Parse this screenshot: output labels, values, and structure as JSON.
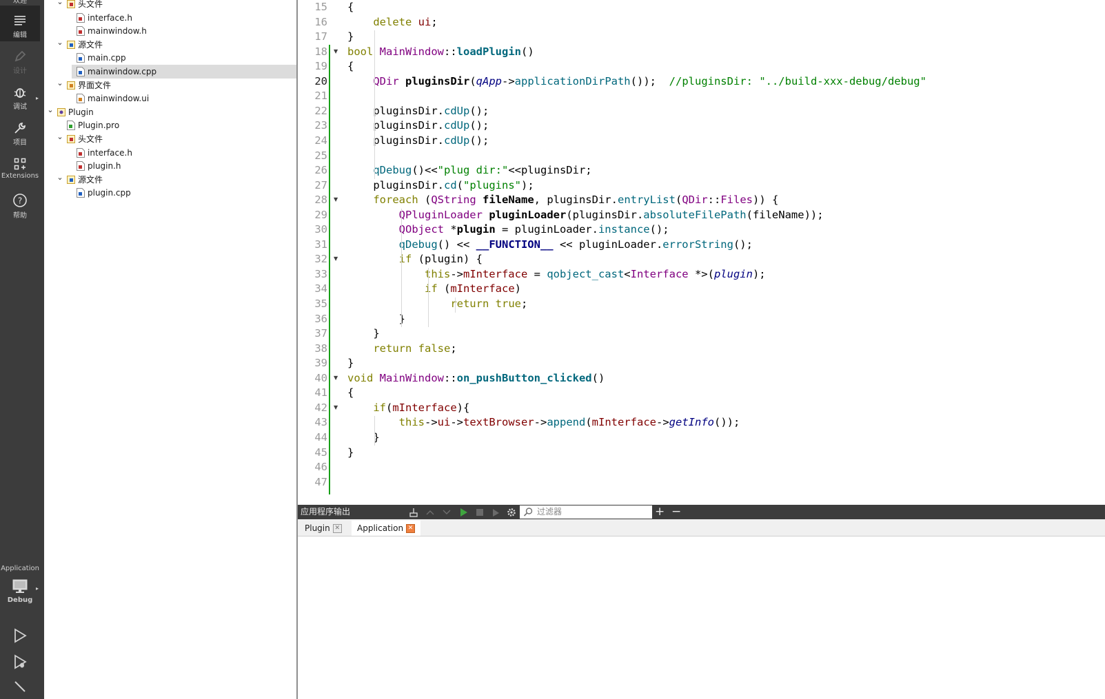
{
  "modes": {
    "welcome": "欢迎",
    "edit": "编辑",
    "design": "设计",
    "debug": "调试",
    "projects": "项目",
    "extensions": "Extensions",
    "help": "帮助"
  },
  "kit": {
    "project": "Application",
    "build": "Debug"
  },
  "tree": {
    "items": [
      {
        "label": "头文件",
        "type": "folder-h"
      },
      {
        "label": "interface.h",
        "type": "h"
      },
      {
        "label": "mainwindow.h",
        "type": "h"
      },
      {
        "label": "源文件",
        "type": "folder-cpp"
      },
      {
        "label": "main.cpp",
        "type": "cpp"
      },
      {
        "label": "mainwindow.cpp",
        "type": "cpp",
        "selected": true
      },
      {
        "label": "界面文件",
        "type": "folder-ui"
      },
      {
        "label": "mainwindow.ui",
        "type": "ui"
      },
      {
        "label": "Plugin",
        "type": "project"
      },
      {
        "label": "Plugin.pro",
        "type": "pro"
      },
      {
        "label": "头文件",
        "type": "folder-h"
      },
      {
        "label": "interface.h",
        "type": "h"
      },
      {
        "label": "plugin.h",
        "type": "h"
      },
      {
        "label": "源文件",
        "type": "folder-cpp"
      },
      {
        "label": "plugin.cpp",
        "type": "cpp"
      }
    ]
  },
  "editor": {
    "current_line": 20,
    "lines": [
      {
        "n": 15,
        "text": "{"
      },
      {
        "n": 16,
        "text": "    delete ui;"
      },
      {
        "n": 17,
        "text": "}"
      },
      {
        "n": 18,
        "text": "bool MainWindow::loadPlugin()"
      },
      {
        "n": 19,
        "text": "{"
      },
      {
        "n": 20,
        "text": "    QDir pluginsDir(qApp->applicationDirPath());  //pluginsDir: \"../build-xxx-debug/debug\""
      },
      {
        "n": 21,
        "text": ""
      },
      {
        "n": 22,
        "text": "    pluginsDir.cdUp();"
      },
      {
        "n": 23,
        "text": "    pluginsDir.cdUp();"
      },
      {
        "n": 24,
        "text": "    pluginsDir.cdUp();"
      },
      {
        "n": 25,
        "text": ""
      },
      {
        "n": 26,
        "text": "    qDebug()<<\"plug dir:\"<<pluginsDir;"
      },
      {
        "n": 27,
        "text": "    pluginsDir.cd(\"plugins\");"
      },
      {
        "n": 28,
        "text": "    foreach (QString fileName, pluginsDir.entryList(QDir::Files)) {"
      },
      {
        "n": 29,
        "text": "        QPluginLoader pluginLoader(pluginsDir.absoluteFilePath(fileName));"
      },
      {
        "n": 30,
        "text": "        QObject *plugin = pluginLoader.instance();"
      },
      {
        "n": 31,
        "text": "        qDebug() << __FUNCTION__ << pluginLoader.errorString();"
      },
      {
        "n": 32,
        "text": "        if (plugin) {"
      },
      {
        "n": 33,
        "text": "            this->mInterface = qobject_cast<Interface *>(plugin);"
      },
      {
        "n": 34,
        "text": "            if (mInterface)"
      },
      {
        "n": 35,
        "text": "                return true;"
      },
      {
        "n": 36,
        "text": "        }"
      },
      {
        "n": 37,
        "text": "    }"
      },
      {
        "n": 38,
        "text": "    return false;"
      },
      {
        "n": 39,
        "text": "}"
      },
      {
        "n": 40,
        "text": "void MainWindow::on_pushButton_clicked()"
      },
      {
        "n": 41,
        "text": "{"
      },
      {
        "n": 42,
        "text": "    if(mInterface){"
      },
      {
        "n": 43,
        "text": "        this->ui->textBrowser->append(mInterface->getInfo());"
      },
      {
        "n": 44,
        "text": "    }"
      },
      {
        "n": 45,
        "text": "}"
      },
      {
        "n": 46,
        "text": ""
      },
      {
        "n": 47,
        "text": ""
      }
    ]
  },
  "output": {
    "title": "应用程序输出",
    "filter_placeholder": "过滤器",
    "plus": "+",
    "minus": "−",
    "tabs": [
      {
        "label": "Plugin",
        "active": false
      },
      {
        "label": "Application",
        "active": true
      }
    ]
  },
  "colors": {
    "sidebar_bg": "#3c3c3c",
    "change_marker": "#18a018",
    "keyword": "#808000",
    "type": "#800080",
    "function": "#00677c",
    "string": "#008000"
  }
}
